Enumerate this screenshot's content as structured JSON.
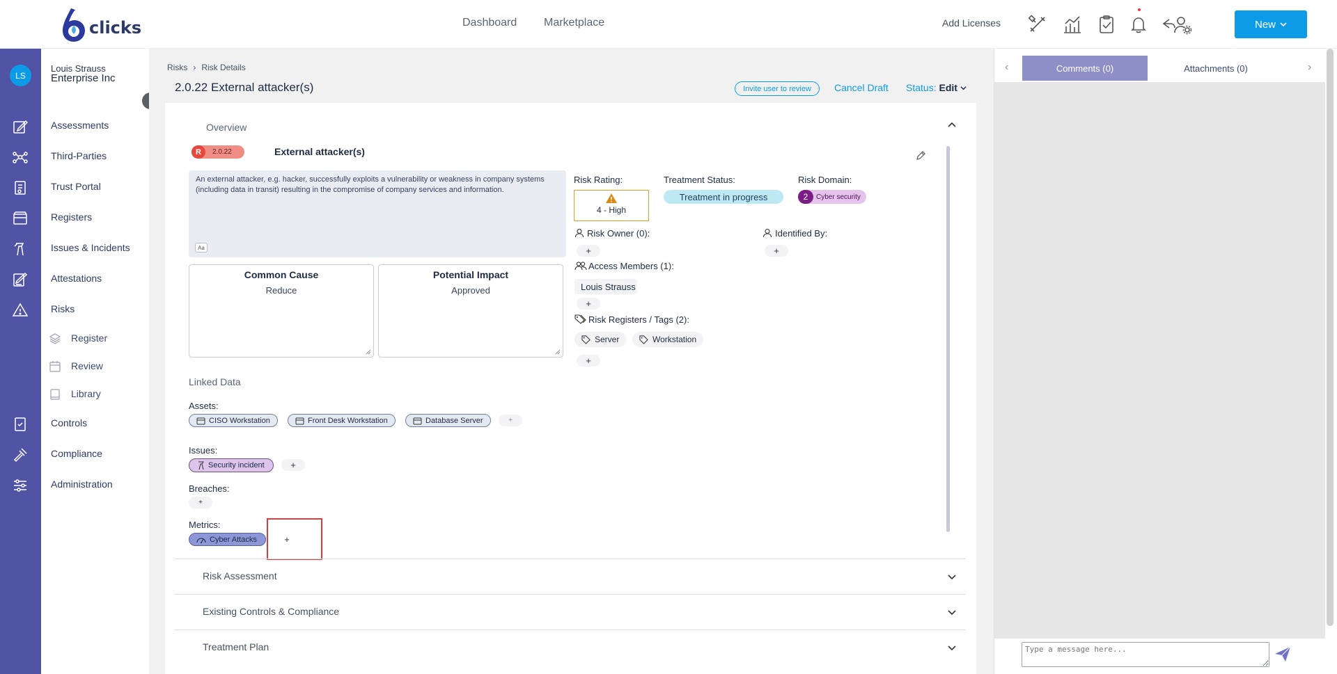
{
  "topnav": {
    "brand": "clicks",
    "dashboard": "Dashboard",
    "marketplace": "Marketplace",
    "add_licenses": "Add Licenses",
    "new_label": "New"
  },
  "user": {
    "initials": "LS",
    "name": "Louis Strauss",
    "org": "Enterprise Inc"
  },
  "menu": {
    "assessments": "Assessments",
    "third_parties": "Third-Parties",
    "trust_portal": "Trust Portal",
    "registers": "Registers",
    "issues": "Issues & Incidents",
    "attestations": "Attestations",
    "risks": "Risks",
    "register": "Register",
    "review": "Review",
    "library": "Library",
    "controls": "Controls",
    "compliance": "Compliance",
    "administration": "Administration"
  },
  "breadcrumb": {
    "root": "Risks",
    "current": "Risk Details"
  },
  "header": {
    "title": "2.0.22 External attacker(s)",
    "invite": "Invite user to review",
    "cancel": "Cancel Draft",
    "status_label": "Status:",
    "status_value": "Edit"
  },
  "overview": {
    "section_title": "Overview",
    "badge_letter": "R",
    "badge_number": "2.0.22",
    "risk_name": "External attacker(s)",
    "description": "An external attacker, e.g. hacker, successfully exploits a vulnerability or weakness in company systems (including data in transit) resulting in the compromise of company services and information.",
    "aa": "Aa",
    "common_cause_title": "Common Cause",
    "common_cause_value": "Reduce",
    "potential_impact_title": "Potential Impact",
    "potential_impact_value": "Approved",
    "risk_rating_label": "Risk Rating:",
    "risk_rating_value": "4 - High",
    "treatment_status_label": "Treatment Status:",
    "treatment_status_value": "Treatment in progress",
    "risk_domain_label": "Risk Domain:",
    "risk_domain_number": "2",
    "risk_domain_value": "Cyber security",
    "risk_owner_label": "Risk Owner (0):",
    "identified_by_label": "Identified By:",
    "access_members_label": "Access Members (1):",
    "access_member_1": "Louis Strauss",
    "registers_tags_label": "Risk Registers / Tags (2):",
    "tag_1": "Server",
    "tag_2": "Workstation",
    "plus": "+"
  },
  "linked": {
    "title": "Linked Data",
    "assets_label": "Assets:",
    "assets": [
      "CISO Workstation",
      "Front Desk Workstation",
      "Database Server"
    ],
    "issues_label": "Issues:",
    "issue_1": "Security incident",
    "breaches_label": "Breaches:",
    "metrics_label": "Metrics:",
    "metric_1": "Cyber Attacks"
  },
  "accordion": {
    "risk_assessment": "Risk Assessment",
    "existing_controls": "Existing Controls & Compliance",
    "treatment_plan": "Treatment Plan"
  },
  "right_panel": {
    "comments_tab": "Comments (0)",
    "attachments_tab": "Attachments (0)",
    "message_placeholder": "Type a message here..."
  },
  "colors": {
    "accent": "#0d9be8",
    "rail": "#5153a4",
    "highlight": "#e03a3a"
  }
}
